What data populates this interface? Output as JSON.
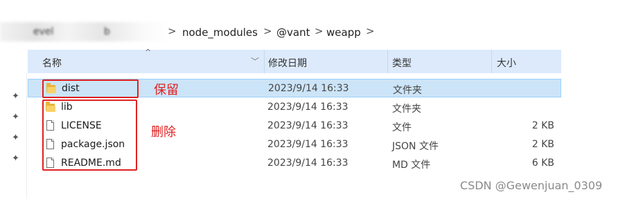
{
  "breadcrumb": {
    "blurred_fragment_1": "evel",
    "blurred_fragment_2": "b",
    "items": [
      "node_modules",
      "@vant",
      "weapp"
    ],
    "separator": ">"
  },
  "columns": {
    "name": "名称",
    "modified": "修改日期",
    "type": "类型",
    "size": "大小"
  },
  "files": [
    {
      "name": "dist",
      "modified": "2023/9/14 16:33",
      "type": "文件夹",
      "size": "",
      "icon": "folder-icon",
      "selected": true
    },
    {
      "name": "lib",
      "modified": "2023/9/14 16:33",
      "type": "文件夹",
      "size": "",
      "icon": "folder-icon",
      "selected": false
    },
    {
      "name": "LICENSE",
      "modified": "2023/9/14 16:33",
      "type": "文件",
      "size": "2 KB",
      "icon": "file-icon",
      "selected": false
    },
    {
      "name": "package.json",
      "modified": "2023/9/14 16:33",
      "type": "JSON 文件",
      "size": "2 KB",
      "icon": "file-icon",
      "selected": false
    },
    {
      "name": "README.md",
      "modified": "2023/9/14 16:33",
      "type": "MD 文件",
      "size": "6 KB",
      "icon": "file-icon",
      "selected": false
    }
  ],
  "annotations": {
    "keep": "保留",
    "delete": "删除",
    "color": "#e02020"
  },
  "watermark": "CSDN @Gewenjuan_0309",
  "colors": {
    "header_bg": "#dceafb",
    "selected_bg": "#cce4f7",
    "folder": "#e9b43a"
  }
}
